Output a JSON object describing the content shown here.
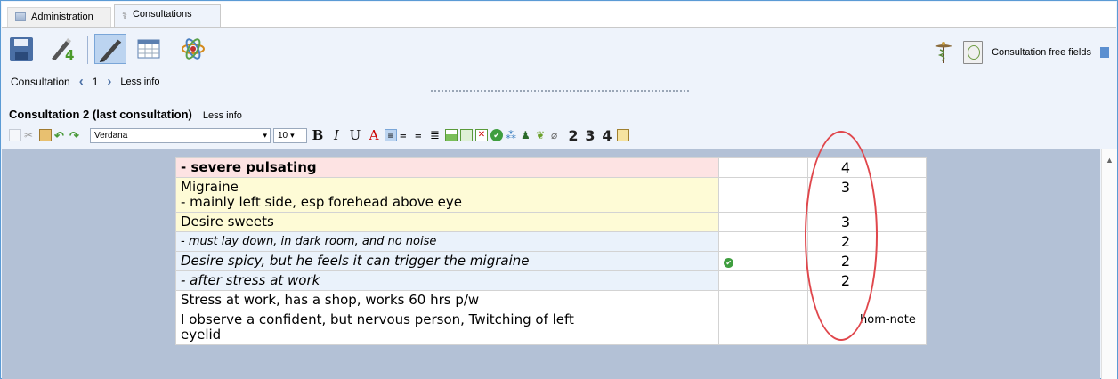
{
  "tabs": [
    {
      "label": "Administration"
    },
    {
      "label": "Consultations"
    }
  ],
  "consultation_nav": {
    "label": "Consultation",
    "number": "1",
    "less_info": "Less info"
  },
  "right_tools": {
    "free_fields_label": "Consultation free fields"
  },
  "consultation2": {
    "title": "Consultation 2 (last consultation)",
    "less_info": "Less info"
  },
  "format_toolbar": {
    "font": "Verdana",
    "size": "10",
    "bold": "B",
    "italic": "I",
    "underline": "U",
    "color": "A",
    "level_buttons": [
      "2",
      "3",
      "4"
    ]
  },
  "rows": [
    {
      "text": "- severe pulsating",
      "text2": "",
      "grade": "4",
      "note": "",
      "style": "pink bold",
      "check": false
    },
    {
      "text": "Migraine",
      "text2": "- mainly left side, esp forehead above eye",
      "grade": "3",
      "note": "",
      "style": "yellow",
      "check": false
    },
    {
      "text": "Desire sweets",
      "text2": "",
      "grade": "3",
      "note": "",
      "style": "yellow",
      "check": false
    },
    {
      "text": "- must lay down, in dark room, and no noise",
      "text2": "",
      "grade": "2",
      "note": "",
      "style": "blue ital small",
      "check": false
    },
    {
      "text": "Desire spicy, but he feels it can trigger the migraine",
      "text2": "",
      "grade": "2",
      "note": "",
      "style": "blue ital",
      "check": true
    },
    {
      "text": "- after stress at work",
      "text2": "",
      "grade": "2",
      "note": "",
      "style": "blue ital",
      "check": false
    },
    {
      "text": "Stress at work, has a shop, works 60 hrs p/w",
      "text2": "",
      "grade": "",
      "note": "",
      "style": "",
      "check": false
    },
    {
      "text": "I observe a confident, but nervous person, Twitching of left",
      "text2": "eyelid",
      "grade": "",
      "note": "hom-note",
      "style": "",
      "check": false
    }
  ],
  "colors": {
    "pink_row": "#fde3e3",
    "yellow_row": "#fefbd6",
    "blue_row": "#eaf2fb",
    "annotation_circle": "#e0474c",
    "doc_background": "#b3c1d6"
  },
  "icons": [
    "save-icon",
    "new-consultation-icon",
    "edit-icon",
    "grid-icon",
    "atom-icon",
    "caduceus-icon",
    "free-fields-icon",
    "check-icon"
  ]
}
